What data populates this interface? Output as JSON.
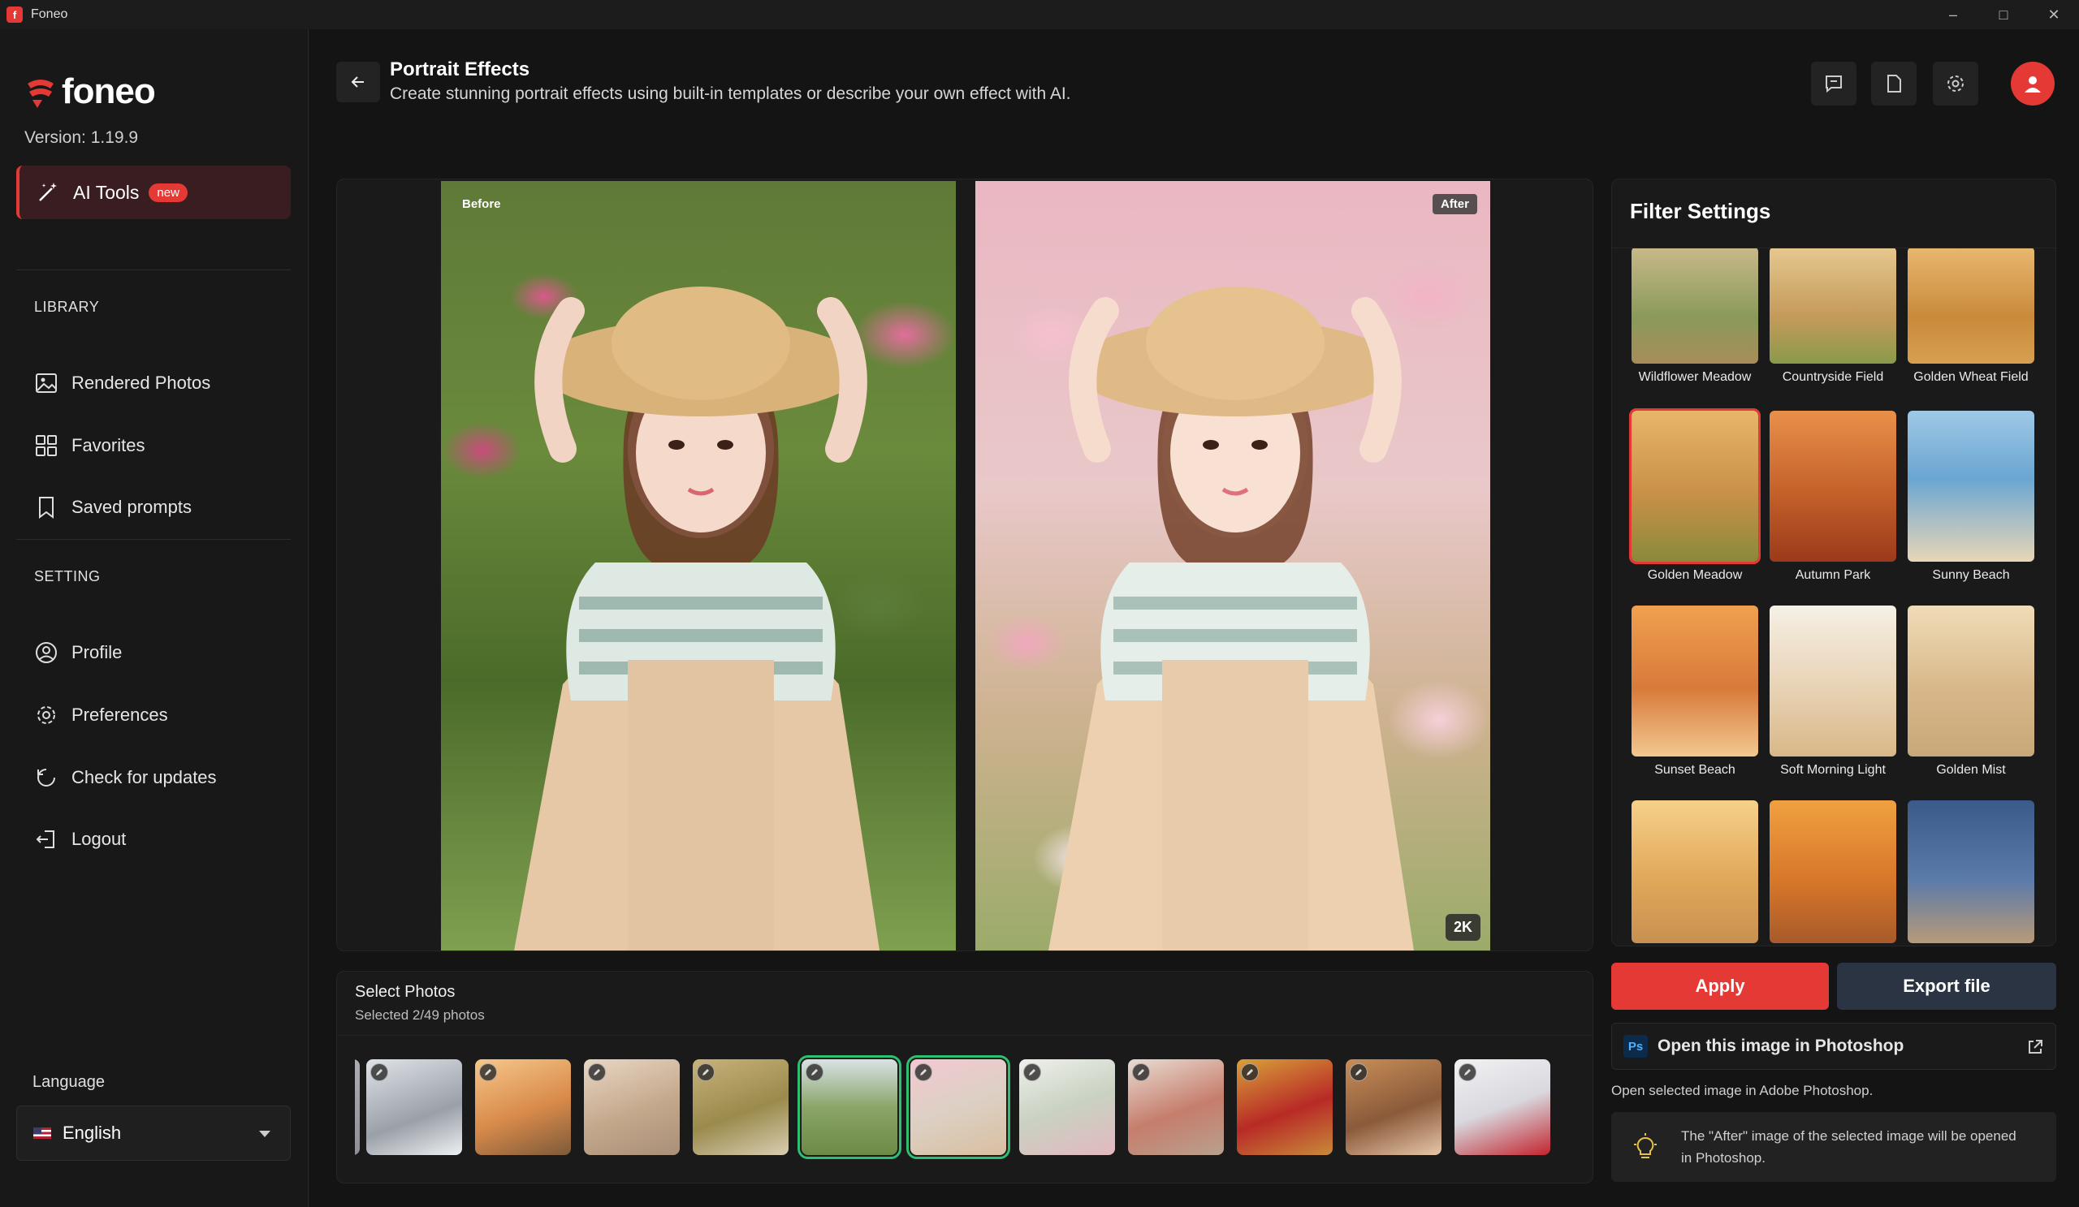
{
  "window": {
    "title": "Foneo"
  },
  "sidebar": {
    "logo": "foneo",
    "version": "Version: 1.19.9",
    "ai_tools": {
      "label": "AI Tools",
      "badge": "new"
    },
    "library_header": "LIBRARY",
    "library": [
      {
        "label": "Rendered Photos",
        "icon": "image-icon"
      },
      {
        "label": "Favorites",
        "icon": "grid-icon"
      },
      {
        "label": "Saved prompts",
        "icon": "bookmark-icon"
      }
    ],
    "setting_header": "SETTING",
    "settings": [
      {
        "label": "Profile",
        "icon": "user-circle-icon"
      },
      {
        "label": "Preferences",
        "icon": "gear-icon"
      },
      {
        "label": "Check for updates",
        "icon": "refresh-icon"
      },
      {
        "label": "Logout",
        "icon": "logout-icon"
      }
    ],
    "language_label": "Language",
    "language_value": "English"
  },
  "header": {
    "title": "Portrait Effects",
    "subtitle": "Create stunning portrait effects using built-in templates or describe your own effect with AI."
  },
  "preview": {
    "before_label": "Before",
    "after_label": "After",
    "resolution": "2K"
  },
  "select_photos": {
    "title": "Select Photos",
    "count": "Selected 2/49 photos",
    "selected_indices": [
      4,
      5
    ]
  },
  "filters": {
    "title": "Filter Settings",
    "items": [
      {
        "name": "Wildflower Meadow"
      },
      {
        "name": "Countryside Field"
      },
      {
        "name": "Golden Wheat Field"
      },
      {
        "name": "Golden Meadow",
        "selected": true
      },
      {
        "name": "Autumn Park"
      },
      {
        "name": "Sunny Beach"
      },
      {
        "name": "Sunset Beach"
      },
      {
        "name": "Soft Morning Light"
      },
      {
        "name": "Golden Mist"
      },
      {
        "name": ""
      },
      {
        "name": ""
      },
      {
        "name": ""
      }
    ]
  },
  "actions": {
    "apply": "Apply",
    "export": "Export file",
    "photoshop_label": "Open this image in Photoshop",
    "photoshop_hint": "Open selected image in Adobe Photoshop.",
    "photoshop_note": "The \"After\" image of the selected image will be opened in Photoshop."
  },
  "colors": {
    "accent": "#e53935",
    "selected_thumb": "#2fbf71",
    "panel": "#1a1a1a",
    "background": "#141414"
  }
}
